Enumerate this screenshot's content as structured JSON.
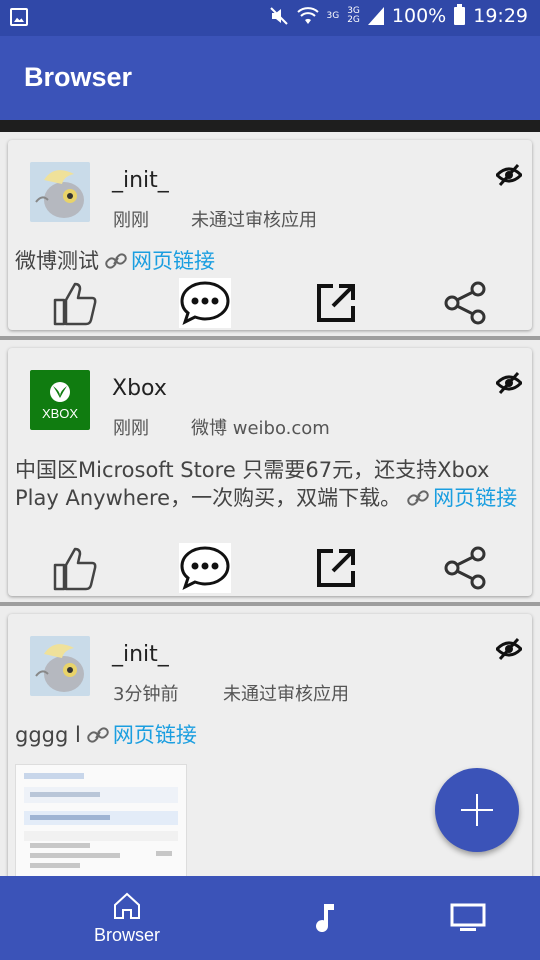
{
  "status_bar": {
    "network_top": "3G",
    "network_mid": "3G",
    "network_bottom": "2G",
    "battery_text": "100%",
    "time": "19:29",
    "icons": [
      "gallery-icon",
      "mute-icon",
      "wifi-icon",
      "signal-icon",
      "battery-icon"
    ]
  },
  "app_bar": {
    "title": "Browser"
  },
  "cards": [
    {
      "name": "_init_",
      "time": "刚刚",
      "source": "未通过审核应用",
      "text": "微博测试",
      "link_label": "网页链接",
      "avatar": "pony-avatar"
    },
    {
      "name": "Xbox",
      "time": "刚刚",
      "source": "微博 weibo.com",
      "text": "中国区Microsoft Store 只需要67元，还支持Xbox Play Anywhere，一次购买，双端下载。",
      "link_label": "网页链接",
      "avatar": "xbox-logo",
      "avatar_label": "XBOX"
    },
    {
      "name": "_init_",
      "time": "3分钟前",
      "source": "未通过审核应用",
      "text": "gggg l",
      "link_label": "网页链接",
      "avatar": "pony-avatar"
    }
  ],
  "bottom_nav": {
    "items": [
      {
        "label": "Browser",
        "icon": "home-icon"
      },
      {
        "label": "",
        "icon": "music-icon"
      },
      {
        "label": "",
        "icon": "tv-icon"
      }
    ]
  },
  "colors": {
    "primary": "#3b53b8",
    "link": "#1a9ee0",
    "xbox": "#107c10"
  }
}
